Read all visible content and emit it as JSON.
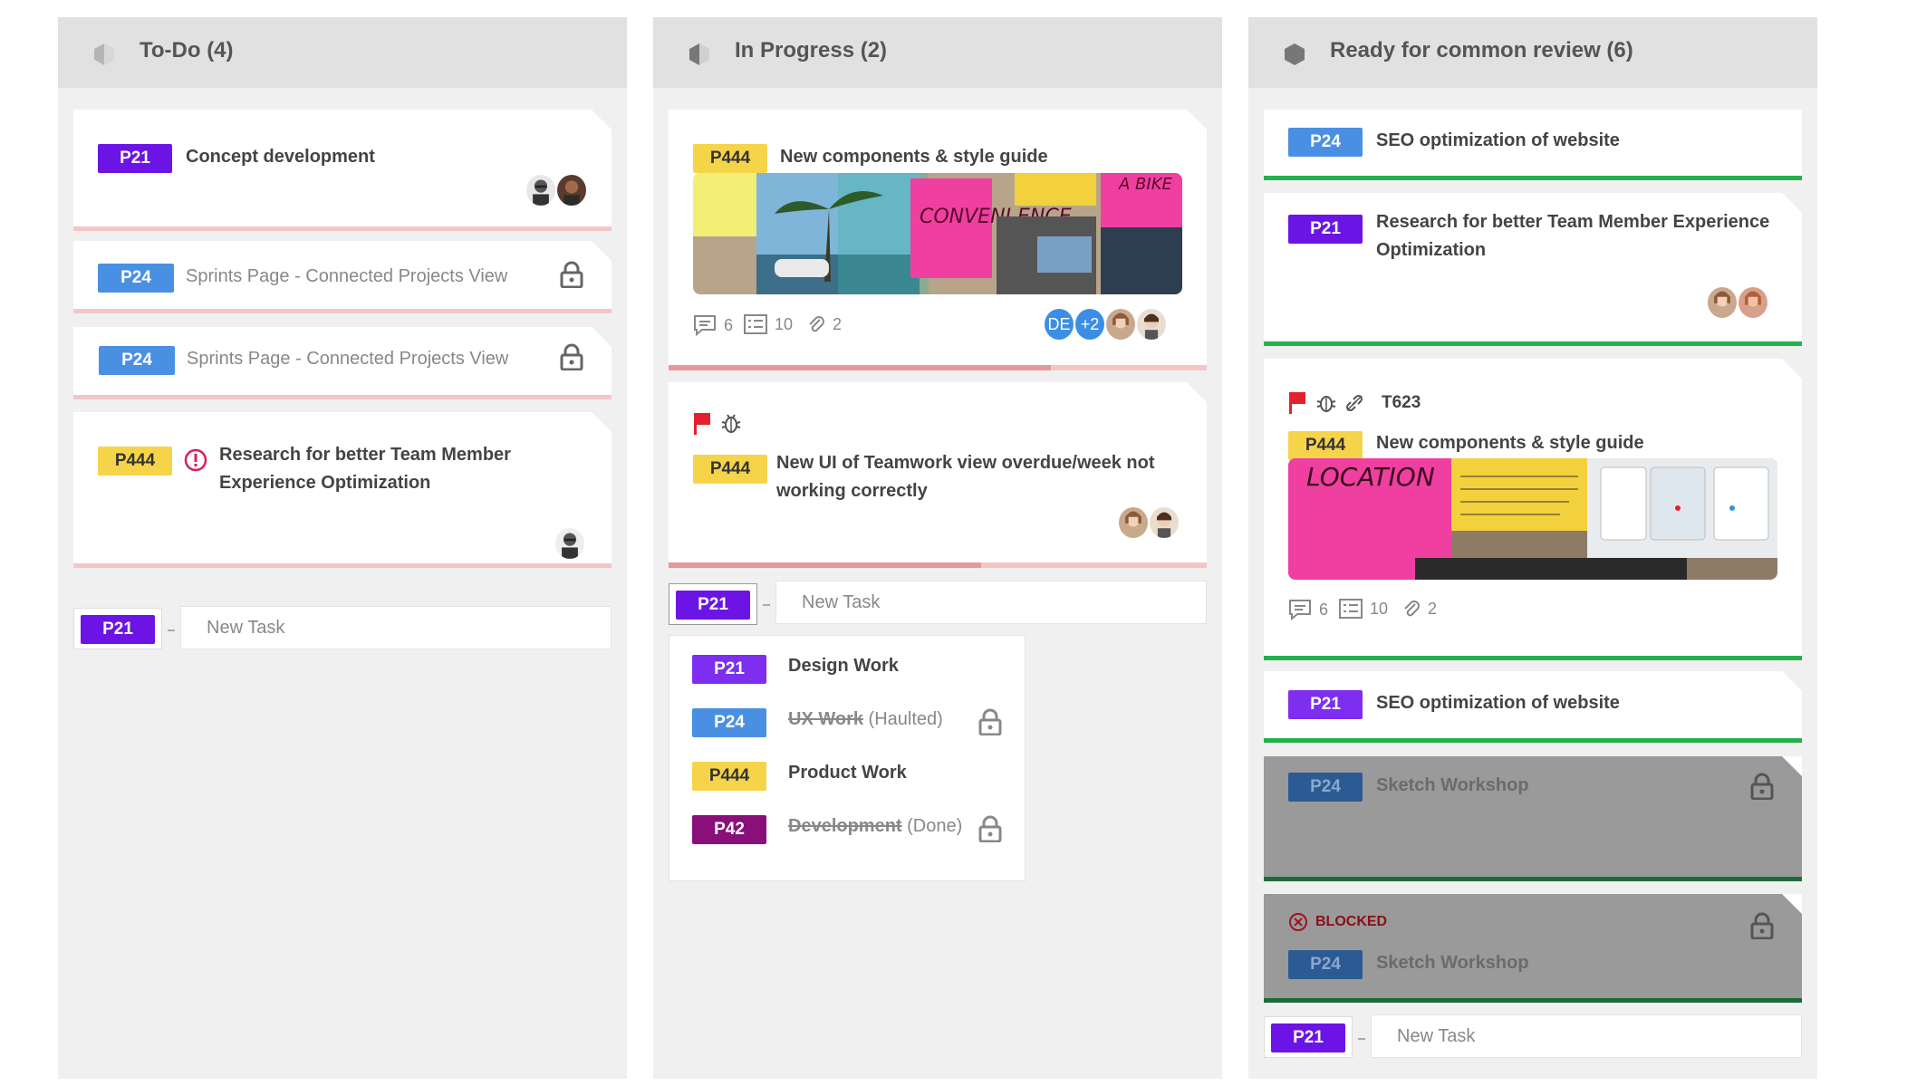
{
  "columns": [
    {
      "title": "To-Do (4)"
    },
    {
      "title": "In Progress (2)"
    },
    {
      "title": "Ready for common review (6)"
    }
  ],
  "todo": {
    "cards": [
      {
        "tag": "P21",
        "title": "Concept development"
      },
      {
        "tag": "P24",
        "title": "Sprints Page - Connected Projects View"
      },
      {
        "tag": "P24",
        "title": "Sprints Page - Connected Projects View"
      },
      {
        "tag": "P444",
        "title_line1": "Research for better Team Member",
        "title_line2": "Experience Optimization"
      }
    ],
    "new_task": {
      "tag": "P21",
      "placeholder": "New Task"
    }
  },
  "in_progress": {
    "card1": {
      "tag": "P444",
      "title": "New components & style guide",
      "comments": "6",
      "checklist": "10",
      "attachments": "2",
      "avatar_initials": "DE",
      "avatar_more": "+2",
      "progress": 0.71
    },
    "card2": {
      "tag": "P444",
      "title_line1": "New UI of Teamwork view overdue/week not",
      "title_line2": "working correctly",
      "progress": 0.58
    },
    "new_task": {
      "tag": "P21",
      "placeholder": "New Task"
    },
    "dropdown": [
      {
        "tag": "P21",
        "label": "Design Work",
        "suffix": ""
      },
      {
        "tag": "P24",
        "label": "UX Work",
        "suffix": " (Haulted)"
      },
      {
        "tag": "P444",
        "label": "Product Work",
        "suffix": ""
      },
      {
        "tag": "P42",
        "label": "Development",
        "suffix": " (Done)"
      }
    ]
  },
  "review": {
    "cards": [
      {
        "tag": "P24",
        "title": "SEO optimization of website"
      },
      {
        "tag": "P21",
        "title_line1": "Research for better Team Member Experience",
        "title_line2": "Optimization"
      },
      {
        "code": "T623",
        "tag": "P444",
        "title": "New components & style guide",
        "comments": "6",
        "checklist": "10",
        "attachments": "2"
      },
      {
        "tag": "P21",
        "title": "SEO optimization of website"
      },
      {
        "tag": "P24",
        "title": "Sketch Workshop"
      },
      {
        "blocked_label": "BLOCKED",
        "tag": "P24",
        "title": "Sketch Workshop"
      }
    ],
    "new_task": {
      "tag": "P21",
      "placeholder": "New Task"
    }
  },
  "image_text": {
    "note_a": "CONVENI ENCE",
    "note_b": "A BIKE",
    "note_c": "LOCATION"
  }
}
